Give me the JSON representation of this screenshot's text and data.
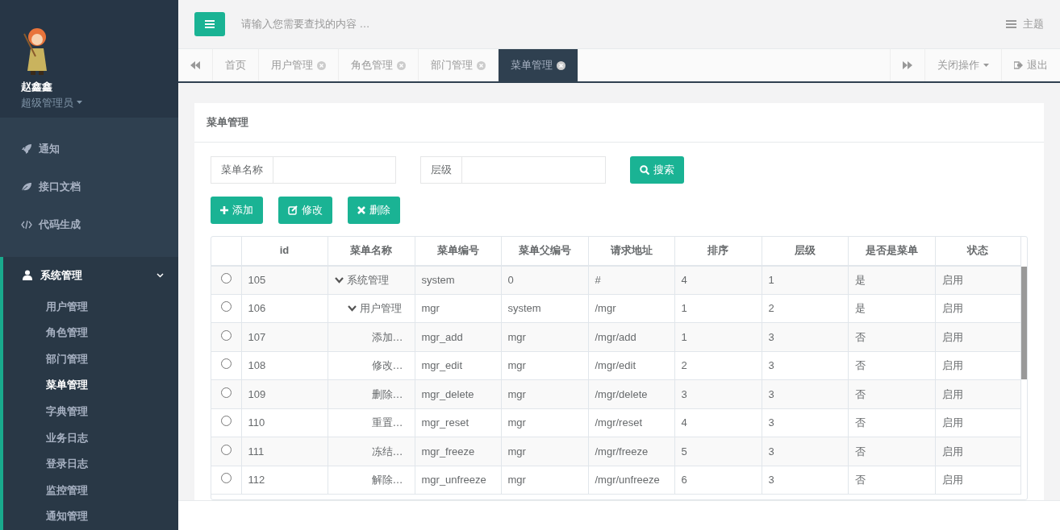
{
  "sidebar": {
    "user": {
      "name": "赵鑫鑫",
      "role": "超级管理员"
    },
    "items": [
      {
        "label": "通知",
        "kind": "rocket"
      },
      {
        "label": "接口文档",
        "kind": "leaf"
      },
      {
        "label": "代码生成",
        "kind": "code"
      },
      {
        "label": "系统管理",
        "kind": "user",
        "expanded": true,
        "children": [
          {
            "label": "用户管理",
            "selected": false
          },
          {
            "label": "角色管理",
            "selected": false
          },
          {
            "label": "部门管理",
            "selected": false
          },
          {
            "label": "菜单管理",
            "selected": true
          },
          {
            "label": "字典管理",
            "selected": false
          },
          {
            "label": "业务日志",
            "selected": false
          },
          {
            "label": "登录日志",
            "selected": false
          },
          {
            "label": "监控管理",
            "selected": false
          },
          {
            "label": "通知管理",
            "selected": false
          }
        ]
      }
    ]
  },
  "header": {
    "search": {
      "placeholder": "请输入您需要查找的内容 …"
    },
    "theme_label": "主题"
  },
  "tabs": [
    {
      "label": "首页",
      "closable": false,
      "selected": false
    },
    {
      "label": "用户管理",
      "closable": true,
      "selected": false
    },
    {
      "label": "角色管理",
      "closable": true,
      "selected": false
    },
    {
      "label": "部门管理",
      "closable": true,
      "selected": false
    },
    {
      "label": "菜单管理",
      "closable": true,
      "selected": true
    }
  ],
  "tab_actions": {
    "close_menu": "关闭操作",
    "logout": "退出"
  },
  "panel": {
    "title": "菜单管理",
    "filters": [
      {
        "label": "菜单名称"
      },
      {
        "label": "层级"
      }
    ],
    "search_button": "搜索",
    "actions": [
      {
        "label": "添加",
        "kind": "add"
      },
      {
        "label": "修改",
        "kind": "edit"
      },
      {
        "label": "删除",
        "kind": "delete"
      }
    ],
    "table": {
      "columns": [
        "id",
        "菜单名称",
        "菜单编号",
        "菜单父编号",
        "请求地址",
        "排序",
        "层级",
        "是否是菜单",
        "状态"
      ],
      "rows": [
        {
          "selected": false,
          "expanded": true,
          "cells": [
            "105",
            "系统管理",
            "system",
            "0",
            "#",
            "4",
            "1",
            "是",
            "启用"
          ],
          "children": [
            {
              "selected": false,
              "expanded": true,
              "cells": [
                "106",
                "用户管理",
                "mgr",
                "system",
                "/mgr",
                "1",
                "2",
                "是",
                "启用"
              ],
              "children": [
                {
                  "selected": false,
                  "cells": [
                    "107",
                    "添加…",
                    "mgr_add",
                    "mgr",
                    "/mgr/add",
                    "1",
                    "3",
                    "否",
                    "启用"
                  ]
                },
                {
                  "selected": false,
                  "cells": [
                    "108",
                    "修改…",
                    "mgr_edit",
                    "mgr",
                    "/mgr/edit",
                    "2",
                    "3",
                    "否",
                    "启用"
                  ]
                },
                {
                  "selected": false,
                  "cells": [
                    "109",
                    "删除…",
                    "mgr_delete",
                    "mgr",
                    "/mgr/delete",
                    "3",
                    "3",
                    "否",
                    "启用"
                  ]
                },
                {
                  "selected": false,
                  "cells": [
                    "110",
                    "重置…",
                    "mgr_reset",
                    "mgr",
                    "/mgr/reset",
                    "4",
                    "3",
                    "否",
                    "启用"
                  ]
                },
                {
                  "selected": false,
                  "cells": [
                    "111",
                    "冻结…",
                    "mgr_freeze",
                    "mgr",
                    "/mgr/freeze",
                    "5",
                    "3",
                    "否",
                    "启用"
                  ]
                },
                {
                  "selected": false,
                  "cells": [
                    "112",
                    "解除…",
                    "mgr_unfreeze",
                    "mgr",
                    "/mgr/unfreeze",
                    "6",
                    "3",
                    "否",
                    "启用"
                  ]
                }
              ]
            }
          ]
        }
      ]
    }
  }
}
